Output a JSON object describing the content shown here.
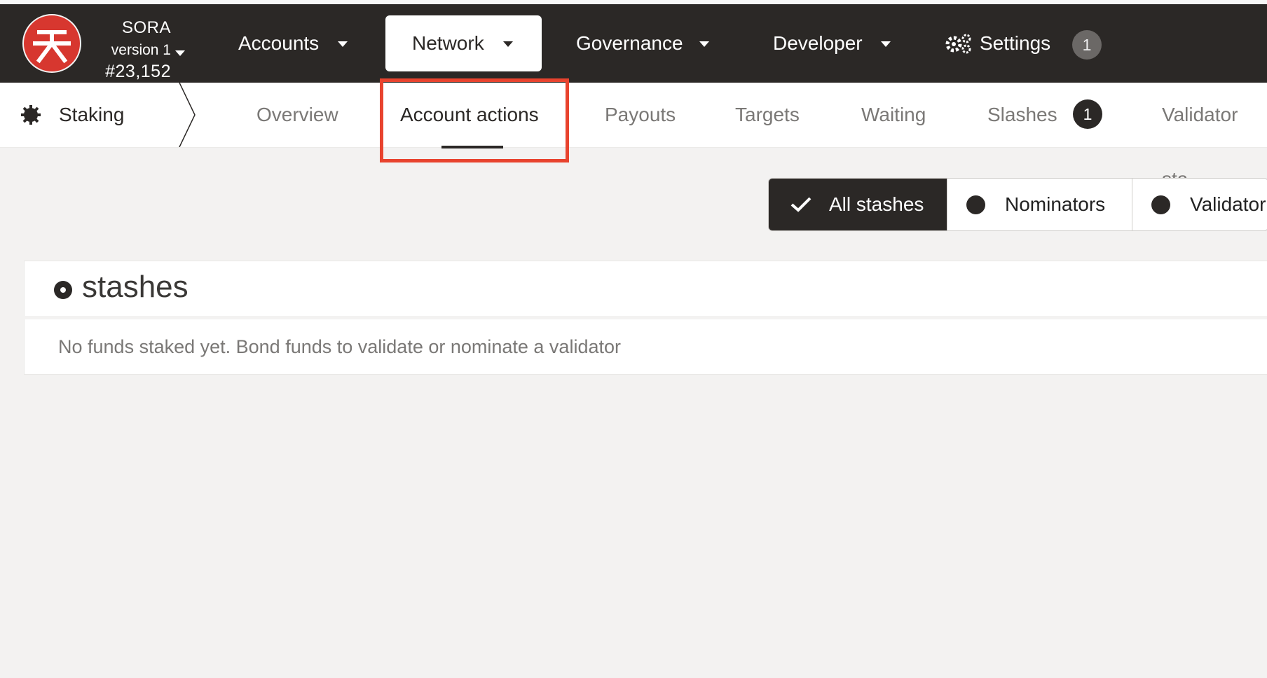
{
  "chain": {
    "name": "SORA",
    "version": "version 1",
    "block": "#23,152"
  },
  "nav": {
    "accounts": "Accounts",
    "network": "Network",
    "governance": "Governance",
    "developer": "Developer",
    "settings": "Settings",
    "settings_badge": "1"
  },
  "section": "Staking",
  "tabs": {
    "overview": "Overview",
    "account_actions": "Account actions",
    "payouts": "Payouts",
    "targets": "Targets",
    "waiting": "Waiting",
    "slashes": "Slashes",
    "slashes_badge": "1",
    "validator_stats": "Validator sta"
  },
  "filters": {
    "all": "All stashes",
    "nominators": "Nominators",
    "validators": "Validator"
  },
  "panel": {
    "title": "stashes",
    "empty": "No funds staked yet. Bond funds to validate or nominate a validator"
  },
  "colors": {
    "brand": "#d7372f",
    "topbar": "#2b2826",
    "highlight": "#e8432e"
  }
}
